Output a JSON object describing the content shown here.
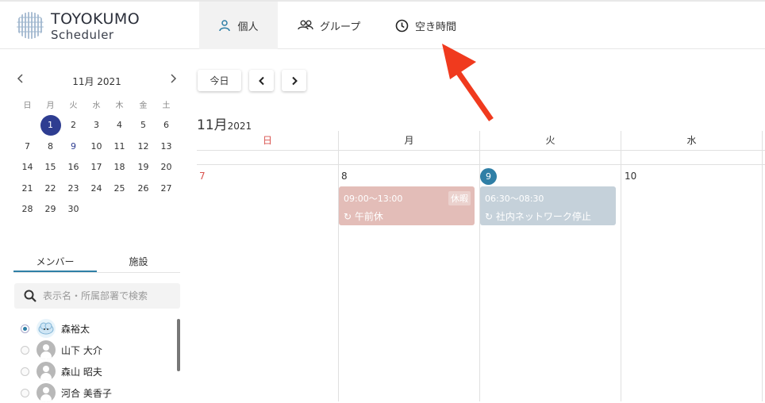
{
  "brand": {
    "name": "TOYOKUMO",
    "product": "Scheduler"
  },
  "nav": {
    "tabs": [
      {
        "label": "個人",
        "icon": "person-icon",
        "active": true
      },
      {
        "label": "グループ",
        "icon": "group-icon",
        "active": false
      },
      {
        "label": "空き時間",
        "icon": "clock-icon",
        "active": false
      }
    ]
  },
  "mini_calendar": {
    "month_label": "11月 2021",
    "prev_icon": "chevron-left-icon",
    "next_icon": "chevron-right-icon",
    "weekdays": [
      "日",
      "月",
      "火",
      "水",
      "木",
      "金",
      "土"
    ],
    "weeks": [
      [
        "",
        "1",
        "2",
        "3",
        "4",
        "5",
        "6"
      ],
      [
        "7",
        "8",
        "9",
        "10",
        "11",
        "12",
        "13"
      ],
      [
        "14",
        "15",
        "16",
        "17",
        "18",
        "19",
        "20"
      ],
      [
        "21",
        "22",
        "23",
        "24",
        "25",
        "26",
        "27"
      ],
      [
        "28",
        "29",
        "30",
        "",
        "",
        "",
        ""
      ]
    ],
    "selected": "1",
    "today": "9"
  },
  "member_tabs": {
    "members": "メンバー",
    "facilities": "施設"
  },
  "search": {
    "placeholder": "表示名・所属部署で検索"
  },
  "members": [
    {
      "name": "森裕太",
      "selected": true,
      "avatar": "cloud"
    },
    {
      "name": "山下 大介",
      "selected": false,
      "avatar": "default"
    },
    {
      "name": "森山 昭夫",
      "selected": false,
      "avatar": "default"
    },
    {
      "name": "河合 美香子",
      "selected": false,
      "avatar": "default"
    }
  ],
  "toolbar": {
    "today": "今日"
  },
  "calendar": {
    "month": "11月",
    "year": "2021",
    "days": [
      {
        "weekday": "日",
        "date": "7"
      },
      {
        "weekday": "月",
        "date": "8"
      },
      {
        "weekday": "火",
        "date": "9"
      },
      {
        "weekday": "水",
        "date": "10"
      }
    ],
    "events": [
      {
        "time": "09:00〜13:00",
        "title": "午前休",
        "tag": "休暇",
        "color": "#e3bdb8"
      },
      {
        "time": "06:30〜08:30",
        "title": "社内ネットワーク停止",
        "tag": "",
        "color": "#c5d1da"
      }
    ]
  },
  "colors": {
    "accent": "#2f7fa6",
    "selected_day": "#2e3d91",
    "sunday": "#d9534f",
    "arrow": "#f03a1e"
  }
}
